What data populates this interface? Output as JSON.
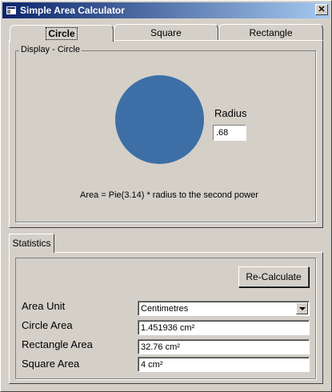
{
  "window": {
    "title": "Simple Area Calculator",
    "close_glyph": "✕"
  },
  "tabs": [
    {
      "label": "Circle",
      "active": true
    },
    {
      "label": "Square",
      "active": false
    },
    {
      "label": "Rectangle",
      "active": false
    }
  ],
  "display": {
    "group_title": "Display - Circle",
    "radius_label": "Radius",
    "radius_value": ".68",
    "formula": "Area = Pie(3.14) * radius to the second power",
    "circle_color": "#3d6fa6"
  },
  "stats": {
    "tab_label": "Statistics",
    "recalc_label": "Re-Calculate",
    "area_unit_label": "Area Unit",
    "area_unit_value": "Centimetres",
    "circle_area_label": "Circle Area",
    "circle_area_value": "1.451936 cm²",
    "rectangle_area_label": "Rectangle Area",
    "rectangle_area_value": "32.76 cm²",
    "square_area_label": "Square Area",
    "square_area_value": "4 cm²"
  },
  "colors": {
    "title_gradient_start": "#0a246a",
    "title_gradient_end": "#a6caf0",
    "face": "#d4d0c8"
  },
  "icons": {
    "app": "app-window-icon",
    "close": "close-icon",
    "dropdown": "chevron-down-icon"
  }
}
